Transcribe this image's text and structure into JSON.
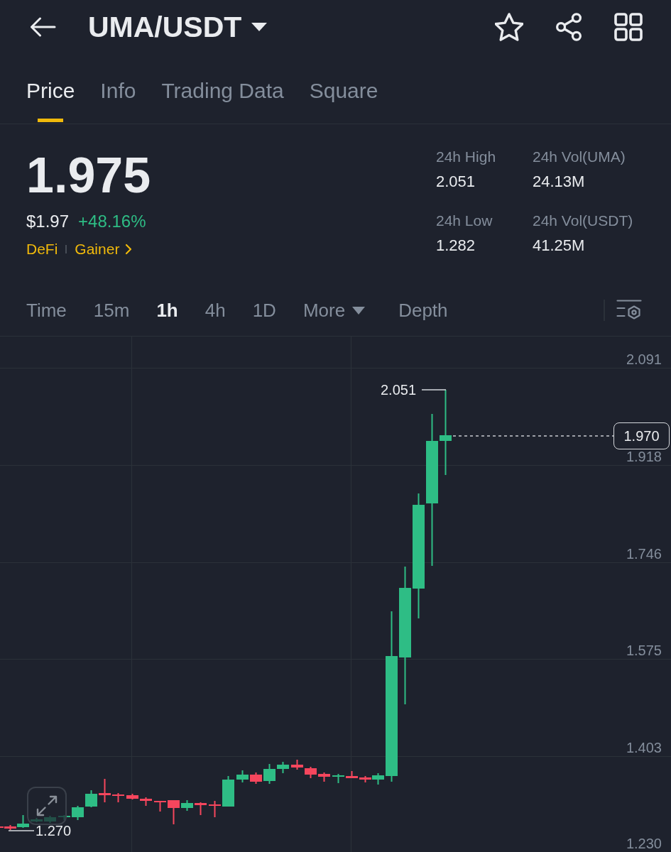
{
  "header": {
    "title": "UMA/USDT"
  },
  "tabs": [
    {
      "label": "Price",
      "selected": true
    },
    {
      "label": "Info",
      "selected": false
    },
    {
      "label": "Trading Data",
      "selected": false
    },
    {
      "label": "Square",
      "selected": false
    }
  ],
  "ticker": {
    "last_price": "1.975",
    "fiat_price": "$1.97",
    "change": "+48.16%",
    "rising": true,
    "tags": [
      {
        "kind": "tag",
        "label": "DeFi"
      },
      {
        "kind": "link",
        "label": "Gainer"
      }
    ]
  },
  "stats": [
    {
      "label": "24h High",
      "value": "2.051"
    },
    {
      "label": "24h Vol(UMA)",
      "value": "24.13M"
    },
    {
      "label": "24h Low",
      "value": "1.282"
    },
    {
      "label": "24h Vol(USDT)",
      "value": "41.25M"
    }
  ],
  "intervals": [
    {
      "kind": "interval",
      "label": "Time",
      "selected": false
    },
    {
      "kind": "interval",
      "label": "15m",
      "selected": false
    },
    {
      "kind": "interval",
      "label": "1h",
      "selected": true
    },
    {
      "kind": "interval",
      "label": "4h",
      "selected": false
    },
    {
      "kind": "interval",
      "label": "1D",
      "selected": false
    },
    {
      "kind": "dropdown",
      "label": "More",
      "selected": false
    },
    {
      "kind": "view",
      "label": "Depth",
      "selected": false
    }
  ],
  "chart": {
    "price_scale": [
      "2.091",
      "1.918",
      "1.746",
      "1.575",
      "1.403",
      "1.230"
    ],
    "high_label": "2.051",
    "low_label": "1.270",
    "last_price_label": "1.970"
  }
}
